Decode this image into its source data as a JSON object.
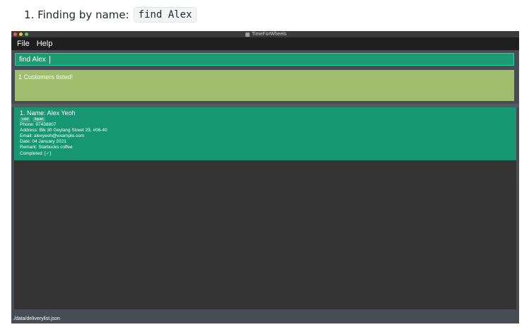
{
  "doc": {
    "heading_prefix": "1. Finding by name:",
    "heading_code": "find Alex"
  },
  "window": {
    "title": "TimeForWheels",
    "menu": [
      "File",
      "Help"
    ]
  },
  "command_box": {
    "value": "find Alex"
  },
  "result_display": {
    "message": "1 Customers listed!"
  },
  "customers": [
    {
      "index_name": "1.  Name: Alex Yeoh",
      "tags": [
        "cold",
        "liquid"
      ],
      "phone": "Phone: 87438807",
      "address": "Address: Blk 30 Geylang Street 29, #06-40",
      "email": "Email: alexyeoh@example.com",
      "date": "Date: 04 January 2021",
      "remark": "Remark: Starbucks coffee",
      "completed": "Completed: [✓]"
    }
  ],
  "status_bar": {
    "path": "./data/deliverylist.json"
  },
  "colors": {
    "command_box": "#1a9b72",
    "result_display": "#9fbd6d",
    "card": "#169673",
    "list_background": "#333333"
  }
}
